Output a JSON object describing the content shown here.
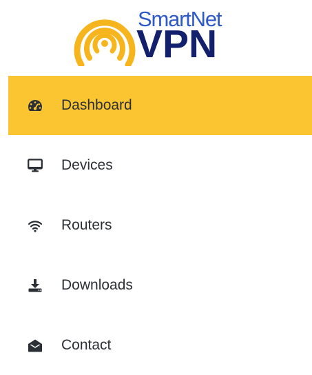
{
  "brand": {
    "name_top": "SmartNet",
    "name_bottom": "VPN",
    "colors": {
      "ring": "#f6b51c",
      "text_top": "#2e59c9",
      "text_bottom": "#13206b"
    }
  },
  "nav": {
    "active_color": "#fbc531",
    "items": [
      {
        "label": "Dashboard",
        "icon": "tachometer-icon",
        "active": true
      },
      {
        "label": "Devices",
        "icon": "monitor-icon",
        "active": false
      },
      {
        "label": "Routers",
        "icon": "wifi-icon",
        "active": false
      },
      {
        "label": "Downloads",
        "icon": "download-icon",
        "active": false
      },
      {
        "label": "Contact",
        "icon": "envelope-open-icon",
        "active": false
      }
    ]
  }
}
